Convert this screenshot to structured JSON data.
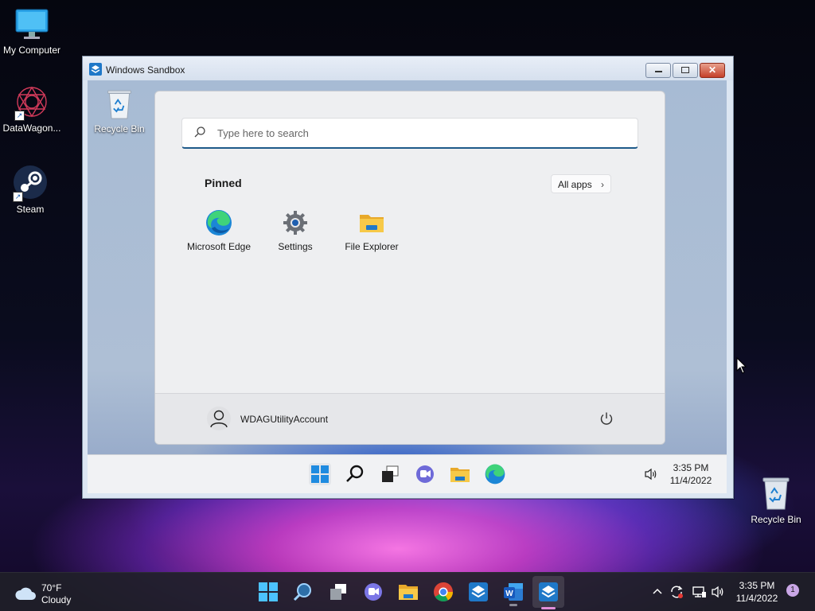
{
  "desktop": {
    "icons": [
      {
        "label": "My Computer"
      },
      {
        "label": "DataWagon..."
      },
      {
        "label": "Steam"
      },
      {
        "label": "Recycle Bin"
      }
    ]
  },
  "sandbox": {
    "title": "Windows Sandbox",
    "desktop_icon_label": "Recycle Bin",
    "start_menu": {
      "search_placeholder": "Type here to search",
      "pinned_heading": "Pinned",
      "all_apps_label": "All apps",
      "pinned_apps": [
        {
          "label": "Microsoft Edge",
          "icon": "edge-icon"
        },
        {
          "label": "Settings",
          "icon": "gear-icon"
        },
        {
          "label": "File Explorer",
          "icon": "folder-icon"
        }
      ],
      "user_name": "WDAGUtilityAccount"
    },
    "taskbar": {
      "time": "3:35 PM",
      "date": "11/4/2022"
    }
  },
  "taskbar": {
    "weather_temp": "70°F",
    "weather_desc": "Cloudy",
    "time": "3:35 PM",
    "date": "11/4/2022",
    "notification_count": "1"
  },
  "colors": {
    "accent": "#0a64c8",
    "search_underline": "#1e5a8a",
    "active_indicator": "#e28fd9"
  }
}
